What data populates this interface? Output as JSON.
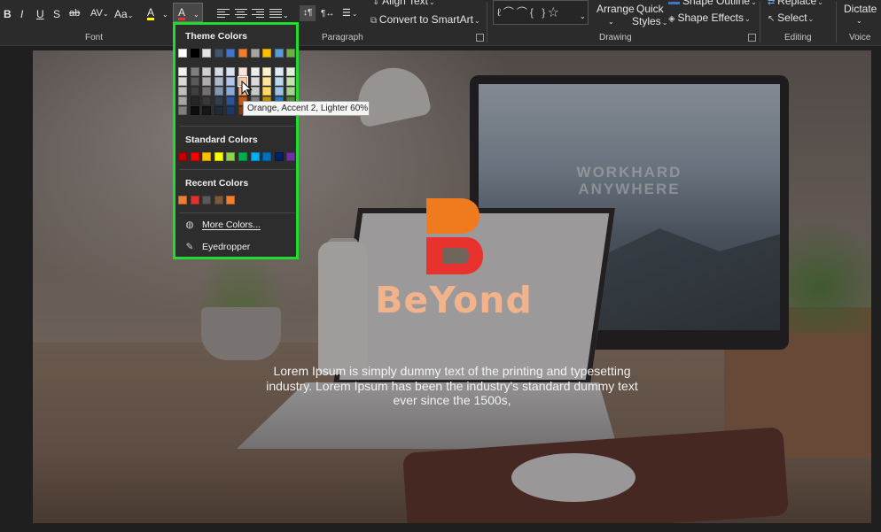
{
  "ribbon": {
    "font_buttons": {
      "bold": "B",
      "italic": "I",
      "underline": "U",
      "shadow": "S",
      "strike": "ab",
      "spacing": "AV",
      "case": "Aa",
      "highlight": "A",
      "color": "A"
    },
    "paragraph": {
      "align_text": "Align Text",
      "smartart": "Convert to SmartArt"
    },
    "drawing": {
      "arrange": "Arrange",
      "quick_styles_1": "Quick",
      "quick_styles_2": "Styles",
      "shape_outline": "Shape Outline",
      "shape_effects": "Shape Effects"
    },
    "editing": {
      "replace": "Replace",
      "select": "Select"
    },
    "voice": {
      "dictate": "Dictate"
    },
    "groups": {
      "font": "Font",
      "paragraph": "Paragraph",
      "drawing": "Drawing",
      "editing": "Editing",
      "voice": "Voice"
    }
  },
  "picker": {
    "theme_heading": "Theme Colors",
    "standard_heading": "Standard Colors",
    "recent_heading": "Recent Colors",
    "more_colors": "More Colors...",
    "eyedropper": "Eyedropper",
    "theme_base": [
      "#ffffff",
      "#000000",
      "#e7e6e6",
      "#44546a",
      "#4472c4",
      "#ed7d31",
      "#a5a5a5",
      "#ffc000",
      "#5b9bd5",
      "#70ad47"
    ],
    "theme_tints": [
      [
        "#f2f2f2",
        "#7f7f7f",
        "#d0cece",
        "#d6dce4",
        "#d9e2f3",
        "#fbe5d6",
        "#ededed",
        "#fff2cc",
        "#deebf6",
        "#e2efd9"
      ],
      [
        "#d9d9d9",
        "#595959",
        "#aeabab",
        "#adb9ca",
        "#b4c6e7",
        "#f7cbac",
        "#dbdbdb",
        "#fee599",
        "#bdd7ee",
        "#c5e0b3"
      ],
      [
        "#bfbfbf",
        "#3f3f3f",
        "#757070",
        "#8496b0",
        "#8eaadb",
        "#f4b183",
        "#c9c9c9",
        "#ffd965",
        "#9cc3e5",
        "#a8d08d"
      ],
      [
        "#a5a5a5",
        "#262626",
        "#3a3838",
        "#323f4f",
        "#2f5496",
        "#c55a11",
        "#7b7b7b",
        "#bf8f00",
        "#2e75b5",
        "#538135"
      ],
      [
        "#7f7f7f",
        "#0c0c0c",
        "#171616",
        "#222a35",
        "#1f3864",
        "#833c0b",
        "#525252",
        "#7f6000",
        "#1e4e79",
        "#375623"
      ]
    ],
    "standard": [
      "#c00000",
      "#ff0000",
      "#ffc000",
      "#ffff00",
      "#92d050",
      "#00b050",
      "#00b0f0",
      "#0070c0",
      "#002060",
      "#7030a0"
    ],
    "recent": [
      "#ed7d31",
      "#e0322f",
      "#595959",
      "#7a5a3a",
      "#f08030"
    ],
    "tooltip": "Orange, Accent 2, Lighter 60%"
  },
  "slide": {
    "screen_title_1": "WORKHARD",
    "screen_title_2": "ANYWHERE",
    "brand": "BeYond",
    "body": "Lorem Ipsum is simply dummy text of the printing and typesetting industry.  Lorem Ipsum has been the industry's standard dummy text ever since the 1500s,",
    "logo_colors": {
      "top": "#f07a1e",
      "bottom": "#e8322e"
    },
    "brand_color": "#f2b28a"
  }
}
